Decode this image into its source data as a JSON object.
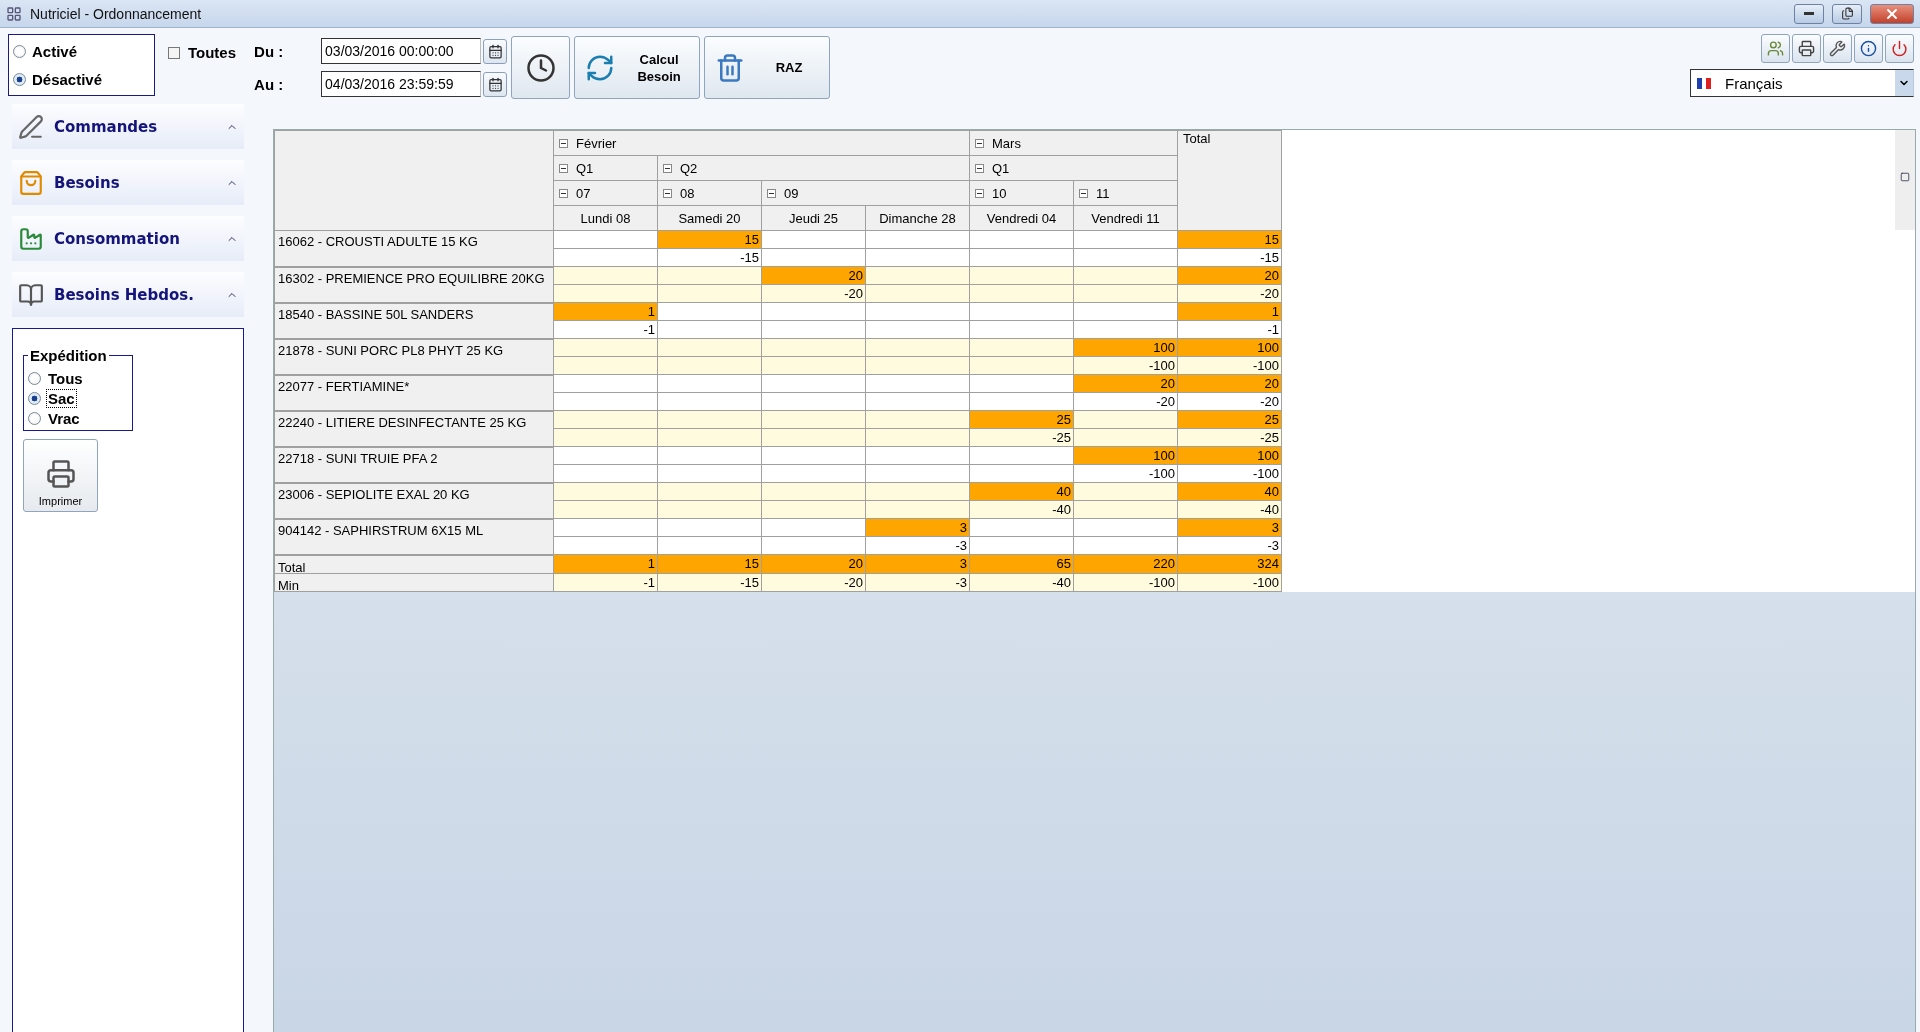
{
  "window": {
    "title": "Nutriciel - Ordonnancement"
  },
  "status_filter": [
    {
      "label": "Activé",
      "selected": false
    },
    {
      "label": "Désactivé",
      "selected": true
    }
  ],
  "all_checkbox": {
    "label": "Toutes",
    "checked": false
  },
  "date_from": {
    "label": "Du :",
    "value": "03/03/2016 00:00:00"
  },
  "date_to": {
    "label": "Au :",
    "value": "04/03/2016 23:59:59"
  },
  "actions": [
    {
      "kind": "clock"
    },
    {
      "kind": "refresh",
      "label": "Calcul Besoin"
    },
    {
      "kind": "trash",
      "label": "RAZ"
    }
  ],
  "toolbar": [
    {
      "kind": "users"
    },
    {
      "kind": "print"
    },
    {
      "kind": "tools"
    },
    {
      "kind": "info"
    },
    {
      "kind": "power"
    }
  ],
  "language": {
    "value": "Français"
  },
  "sidebar": [
    {
      "kind": "orders",
      "label": "Commandes"
    },
    {
      "kind": "needs",
      "label": "Besoins"
    },
    {
      "kind": "consumption",
      "label": "Consommation"
    },
    {
      "kind": "weekly",
      "label": "Besoins Hebdos."
    }
  ],
  "expedition": {
    "title": "Expédition",
    "options": [
      {
        "label": "Tous",
        "selected": false
      },
      {
        "label": "Sac",
        "selected": true
      },
      {
        "label": "Vrac",
        "selected": false
      }
    ]
  },
  "print_button": {
    "label": "Imprimer"
  },
  "pivot": {
    "total_label": "Total",
    "months": [
      {
        "label": "Février",
        "expanded": true,
        "children": [
          {
            "label": "Q1",
            "expanded": true,
            "children": [
              {
                "label": "07",
                "expanded": true,
                "children": [
                  {
                    "label": "Lundi 08"
                  }
                ]
              }
            ]
          },
          {
            "label": "Q2",
            "expanded": true,
            "children": [
              {
                "label": "08",
                "expanded": true,
                "children": [
                  {
                    "label": "Samedi 20"
                  }
                ]
              },
              {
                "label": "09",
                "expanded": true,
                "children": [
                  {
                    "label": "Jeudi 25"
                  },
                  {
                    "label": "Dimanche 28"
                  }
                ]
              }
            ]
          }
        ]
      },
      {
        "label": "Mars",
        "expanded": true,
        "children": [
          {
            "label": "Q1",
            "expanded": true,
            "children": [
              {
                "label": "10",
                "expanded": true,
                "children": [
                  {
                    "label": "Vendredi 04"
                  }
                ]
              },
              {
                "label": "11",
                "expanded": true,
                "children": [
                  {
                    "label": "Vendredi 11"
                  }
                ]
              }
            ]
          }
        ]
      }
    ],
    "rows": [
      {
        "label": "16062 - CROUSTI ADULTE 15 KG",
        "cells": [
          {},
          {
            "value": "15",
            "min": "-15"
          },
          {},
          {},
          {},
          {},
          {
            "value": "15",
            "min": "-15"
          }
        ]
      },
      {
        "label": "16302 - PREMIENCE PRO EQUILIBRE 20KG",
        "cells": [
          {},
          {},
          {
            "value": "20",
            "min": "-20"
          },
          {},
          {},
          {},
          {
            "value": "20",
            "min": "-20"
          }
        ]
      },
      {
        "label": "18540 - BASSINE 50L SANDERS",
        "cells": [
          {
            "value": "1",
            "min": "-1"
          },
          {},
          {},
          {},
          {},
          {},
          {
            "value": "1",
            "min": "-1"
          }
        ]
      },
      {
        "label": "21878 - SUNI PORC PL8 PHYT 25 KG",
        "cells": [
          {},
          {},
          {},
          {},
          {},
          {
            "value": "100",
            "min": "-100"
          },
          {
            "value": "100",
            "min": "-100"
          }
        ]
      },
      {
        "label": "22077 - FERTIAMINE*",
        "cells": [
          {},
          {},
          {},
          {},
          {},
          {
            "value": "20",
            "min": "-20"
          },
          {
            "value": "20",
            "min": "-20"
          }
        ]
      },
      {
        "label": "22240 - LITIERE DESINFECTANTE 25 KG",
        "cells": [
          {},
          {},
          {},
          {},
          {
            "value": "25",
            "min": "-25"
          },
          {},
          {
            "value": "25",
            "min": "-25"
          }
        ]
      },
      {
        "label": "22718 - SUNI TRUIE PFA 2",
        "cells": [
          {},
          {},
          {},
          {},
          {},
          {
            "value": "100",
            "min": "-100"
          },
          {
            "value": "100",
            "min": "-100"
          }
        ]
      },
      {
        "label": "23006 - SEPIOLITE EXAL 20 KG",
        "cells": [
          {},
          {},
          {},
          {},
          {
            "value": "40",
            "min": "-40"
          },
          {},
          {
            "value": "40",
            "min": "-40"
          }
        ]
      },
      {
        "label": "904142 - SAPHIRSTRUM 6X15 ML",
        "cells": [
          {},
          {},
          {},
          {
            "value": "3",
            "min": "-3"
          },
          {},
          {},
          {
            "value": "3",
            "min": "-3"
          }
        ]
      }
    ],
    "total_row": {
      "label": "Total",
      "values": [
        "1",
        "15",
        "20",
        "3",
        "65",
        "220",
        "324"
      ]
    },
    "min_row": {
      "label": "Min",
      "values": [
        "-1",
        "-15",
        "-20",
        "-3",
        "-40",
        "-100",
        "-100"
      ]
    }
  }
}
